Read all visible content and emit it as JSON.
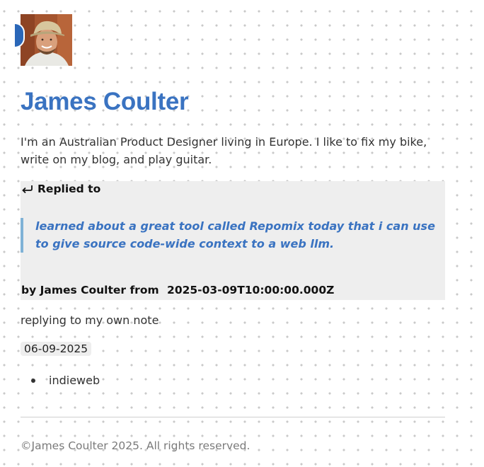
{
  "profile": {
    "name": "James Coulter",
    "bio": "I'm an Australian Product Designer living in Europe. I like to fix my bike, write on my blog, and play guitar.",
    "avatar_icon": "profile-photo",
    "accent_color": "#3a73c1"
  },
  "reply": {
    "heading": "Replied to",
    "icon": "reply-arrow-icon",
    "quote": "learned about a great tool called Repomix today that i can use to give source code-wide context to a web llm.",
    "byline_prefix": "by James Coulter from",
    "timestamp": "2025-03-09T10:00:00.000Z"
  },
  "note": {
    "text": "replying to my own note",
    "date": "06-09-2025",
    "tags": [
      "indieweb"
    ]
  },
  "footer": {
    "copyright": "©James Coulter 2025. All rights reserved."
  }
}
